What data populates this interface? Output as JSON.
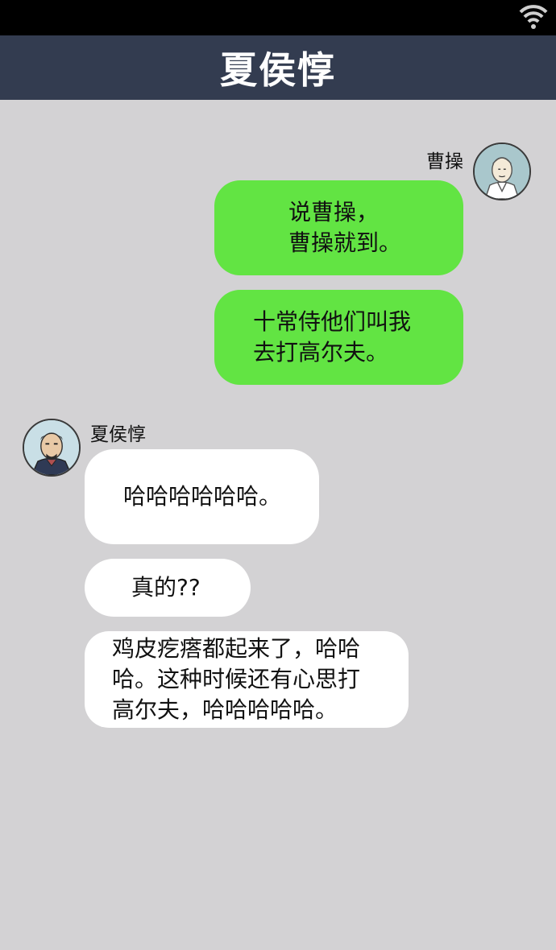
{
  "header": {
    "title": "夏侯惇"
  },
  "status_bar": {
    "wifi_icon": "wifi-icon"
  },
  "colors": {
    "status_bar": "#000000",
    "title_bar": "#333c50",
    "chat_background": "#d3d2d4",
    "outgoing_bubble": "#62e443",
    "incoming_bubble": "#ffffff"
  },
  "thread": {
    "outgoing": {
      "sender": "曹操",
      "avatar_icon": "cao-cao-avatar",
      "messages": [
        "说曹操，\n曹操就到。",
        "十常侍他们叫我\n去打高尔夫。"
      ]
    },
    "incoming": {
      "sender": "夏侯惇",
      "avatar_icon": "xiahou-dun-avatar",
      "messages": [
        "哈哈哈哈哈哈。",
        "真的??",
        "鸡皮疙瘩都起来了，哈哈\n哈。这种时候还有心思打\n高尔夫，哈哈哈哈哈。"
      ]
    }
  }
}
